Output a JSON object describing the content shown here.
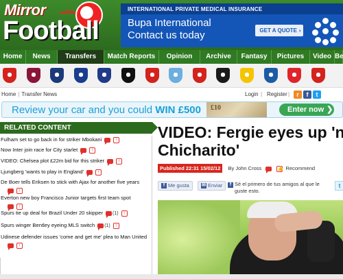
{
  "logo": {
    "mirror": "Mirror",
    "football": "Football"
  },
  "ad": {
    "topline": "INTERNATIONAL PRIVATE MEDICAL INSURANCE",
    "line1": "Bupa International",
    "line2": "Contact us today",
    "cta": "GET A QUOTE",
    "cta_arrow": "›"
  },
  "nav": {
    "items": [
      {
        "label": "Home",
        "w": 38
      },
      {
        "label": "News",
        "w": 46
      },
      {
        "label": "Transfers",
        "w": 68,
        "active": true
      },
      {
        "label": "Match Reports",
        "w": 80
      },
      {
        "label": "Opinion",
        "w": 60
      },
      {
        "label": "Archive",
        "w": 54
      },
      {
        "label": "Fantasy",
        "w": 50
      },
      {
        "label": "Pictures",
        "w": 56
      },
      {
        "label": "Video",
        "w": 36
      },
      {
        "label": "Bet",
        "w": 12
      }
    ]
  },
  "crests": {
    "colors": [
      "#d4221c",
      "#8a1538",
      "#1b3a7a",
      "#1a3d8f",
      "#203a8a",
      "#111111",
      "#d4221c",
      "#6caee0",
      "#d4221c",
      "#1a1a1a",
      "#f5c400",
      "#1d5ba4",
      "#e0242b",
      "#d4221c"
    ]
  },
  "breadcrumb": {
    "home": "Home",
    "sep": "|",
    "section": "Transfer News",
    "login": "Login",
    "register": "Register",
    "bar": "|"
  },
  "social": {
    "rss": "r",
    "facebook": "f",
    "twitter": "t"
  },
  "carad": {
    "text": "Review your car and you could ",
    "win": "WIN £500",
    "notes": "£10",
    "enter": "Enter now",
    "enter_arrow": "❯"
  },
  "related": {
    "title": "RELATED CONTENT",
    "items": [
      {
        "text": "Fulham set to go back in for striker Mbokani",
        "count": ""
      },
      {
        "text": "Now Inter join race for City starlet",
        "count": ""
      },
      {
        "text": "VIDEO: Chelsea plot £22m bid for this striker",
        "count": ""
      },
      {
        "text": "Ljungberg 'wants to play in England'",
        "count": ""
      },
      {
        "text": "De Boer tells Eriksen to stick with Ajax for another five years",
        "count": ""
      },
      {
        "text": "Everton new boy Francisco Junior targets first team spot",
        "count": ""
      },
      {
        "text": "Spurs tie up deal for Brazil Under 20 skipper",
        "count": "(1)"
      },
      {
        "text": "Spurs winger Bentley eyeing MLS switch",
        "count": "(1)"
      },
      {
        "text": "Udinese defender issues 'come and get me' plea to Man United",
        "count": ""
      }
    ]
  },
  "article": {
    "headline_line1": "VIDEO: Fergie eyes up 'n",
    "headline_line2": "Chicharito'",
    "published": "Published 22:31 15/02/12",
    "by": "By John Cross",
    "recommend": "Recommend"
  },
  "fb": {
    "like": "Me gusta",
    "send": "Enviar",
    "msg": "Sé el primero de tus amigos al que le guste esto."
  },
  "colors": {
    "nav_green": "#2f7a22",
    "accent_red": "#d7261e",
    "ad_blue": "#1456b8",
    "carad_blue": "#1aa0d8"
  }
}
